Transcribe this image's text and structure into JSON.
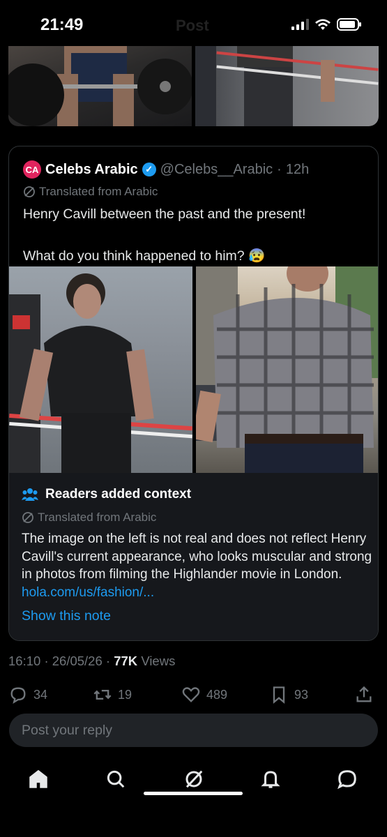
{
  "status_bar": {
    "time": "21:49",
    "header_ghost": "Post"
  },
  "quoted_post": {
    "logo_text": "CA",
    "display_name": "Celebs Arabic",
    "handle": "@Celebs__Arabic",
    "dot": "·",
    "age": "12h",
    "translated_label": "Translated from Arabic",
    "text_line_1": "Henry Cavill between the past and the present!",
    "text_line_2": "What do you think happened to him? 😰"
  },
  "context_note": {
    "title": "Readers added context",
    "translated_label": "Translated from Arabic",
    "body": "The image on the left is not real and does not reflect Henry Cavill's current appearance, who looks muscular and strong in photos from filming the Highlander movie in London. ",
    "link": "hola.com/us/fashion/...",
    "show_note": "Show this note"
  },
  "meta": {
    "time": "16:10",
    "sep1": "·",
    "date": "26/05/26",
    "sep2": "·",
    "views_count": "77K",
    "views_label": "Views"
  },
  "actions": {
    "replies": "34",
    "reposts": "19",
    "likes": "489",
    "bookmarks": "93"
  },
  "reply_placeholder": "Post your reply",
  "colors": {
    "accent": "#1d9bf0",
    "background": "#000000",
    "muted": "#71767b",
    "note_background": "#16181c",
    "brand_logo": "#e0245e"
  },
  "icons": {
    "nav": [
      "home-icon",
      "search-icon",
      "grok-icon",
      "notifications-icon",
      "messages-icon"
    ],
    "actions": [
      "reply-icon",
      "repost-icon",
      "like-icon",
      "bookmark-icon",
      "share-icon"
    ]
  }
}
